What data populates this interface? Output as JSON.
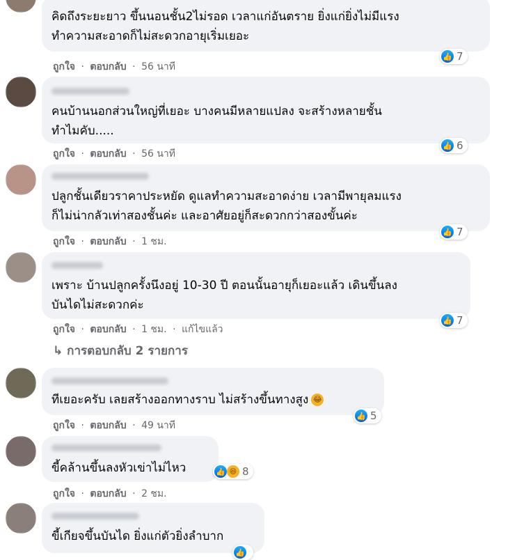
{
  "actions": {
    "like": "ถูกใจ",
    "reply": "ตอบกลับ",
    "edited": "แก้ไขแล้ว",
    "dot": "·"
  },
  "view_replies": "↳ การตอบกลับ 2 รายการ",
  "colors": {
    "bubble": "#f0f2f5",
    "meta": "#65676b",
    "like_blue": "#1877f2"
  },
  "comments": [
    {
      "lines": [
        "คิดถึงระยะยาว ขึ้นนอนชั้น2ไม่รอด เวลาแก่อันตราย ยิ่งแก่ยิ่งไม่มีแรง",
        "ทำความสะอาดก็ไม่สะดวกอายุเริ่มเยอะ"
      ],
      "time": "56 นาที",
      "reactions": "7"
    },
    {
      "lines": [
        "คนบ้านนอกส่วนใหญ่ที่เยอะ บางคนมีหลายแปลง จะสร้างหลายชั้น",
        "ทำไมคับ....."
      ],
      "time": "56 นาที",
      "reactions": "6"
    },
    {
      "lines": [
        "ปลูกชั้นเดียวราคาประหยัด ดูแลทำความสะอาดง่าย เวลามีพายุลมแรง",
        "ก็ไม่น่ากลัวเท่าสองชั้นค่ะ และอาศัยอยู่ก็สะดวกกว่าสองขั้นค่ะ"
      ],
      "time": "1 ชม.",
      "reactions": "7"
    },
    {
      "lines": [
        "เพราะ บ้านปลูกครั้งนึงอยู่ 10-30 ปี ตอนนั้นอายุก็เยอะแล้ว เดินขึ้นลง",
        "บันไดไม่สะดวกค่ะ"
      ],
      "time": "1 ชม.",
      "reactions": "7"
    },
    {
      "lines": [
        "ทีเยอะครับ เลยสร้างออกทางราบ ไม่สร้างขึ้นทางสูง"
      ],
      "time": "49 นาที",
      "reactions": "5"
    },
    {
      "lines": [
        "ขี้คล้านขึ้นลงหัวเข่าไม่ไหว"
      ],
      "time": "2 ชม.",
      "reactions": "8"
    },
    {
      "lines": [
        "ขี้เกียจขึ้นบันได ยิ่งแก่ตัวยิ่งลำบาก"
      ],
      "time": "",
      "reactions": ""
    }
  ]
}
